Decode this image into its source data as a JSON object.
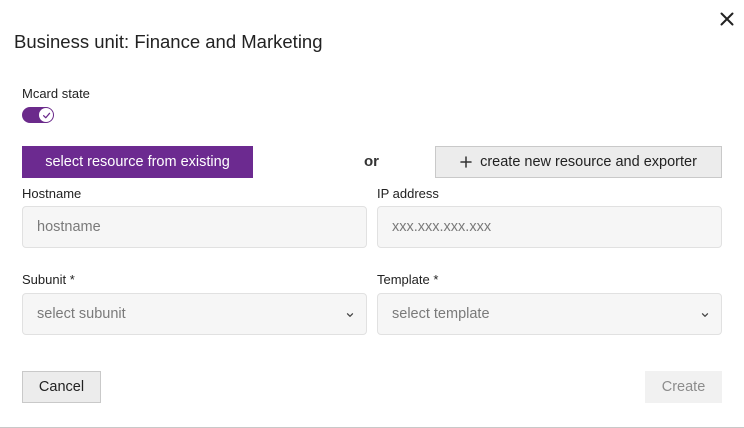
{
  "dialog": {
    "title": "Business unit: Finance and Marketing",
    "close_icon": "close-icon"
  },
  "mcard": {
    "label": "Mcard state",
    "enabled": true,
    "toggle_color": "#6b2a8b"
  },
  "resource": {
    "select_existing_label": "select resource from existing",
    "or_text": "or",
    "create_new_label": "create new resource and exporter",
    "create_new_icon": "plus-icon"
  },
  "fields": {
    "hostname": {
      "label": "Hostname",
      "value": "",
      "placeholder": "hostname"
    },
    "ip_address": {
      "label": "IP address",
      "value": "",
      "placeholder": "xxx.xxx.xxx.xxx"
    },
    "subunit": {
      "label": "Subunit *",
      "selected": "select subunit"
    },
    "template": {
      "label": "Template *",
      "selected": "select template"
    }
  },
  "footer": {
    "cancel_label": "Cancel",
    "create_label": "Create"
  },
  "colors": {
    "primary": "#6c2a90",
    "secondary_button": "#ececec",
    "input_background": "#f6f6f6"
  }
}
